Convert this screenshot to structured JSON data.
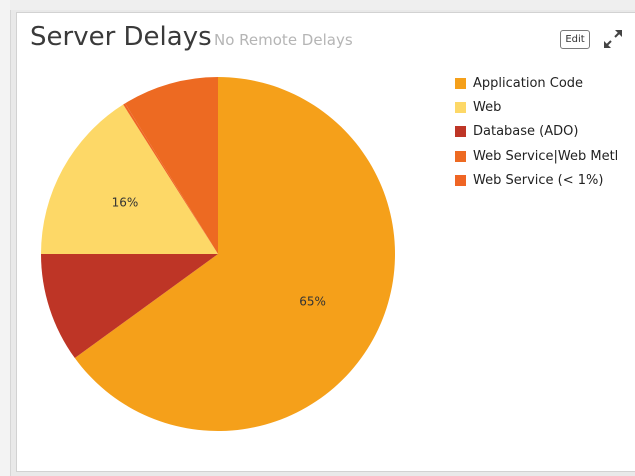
{
  "widget": {
    "title": "Server Delays",
    "subtitle": "No Remote Delays",
    "edit_label": "Edit",
    "expand_icon": "expand-icon"
  },
  "chart_data": {
    "type": "pie",
    "slices": [
      {
        "name": "Application Code",
        "value": 65,
        "color": "#f5a01a",
        "label": "65%"
      },
      {
        "name": "Database (ADO)",
        "value": 10,
        "color": "#be3526",
        "label": ""
      },
      {
        "name": "Web",
        "value": 16,
        "color": "#fdd867",
        "label": "16%"
      },
      {
        "name": "Web Service (< 1%)",
        "value": 0.2,
        "color": "#ef6524",
        "label": ""
      },
      {
        "name": "Web Service|Web Metl",
        "value": 8.8,
        "color": "#ed6a22",
        "label": ""
      }
    ],
    "legend": [
      {
        "name": "Application Code",
        "color": "#f5a01a"
      },
      {
        "name": "Web",
        "color": "#fdd867"
      },
      {
        "name": "Database (ADO)",
        "color": "#be3526"
      },
      {
        "name": "Web Service|Web Metl",
        "color": "#ed6a22"
      },
      {
        "name": "Web Service (< 1%)",
        "color": "#ef6524"
      }
    ],
    "legend_position": "top-right"
  }
}
